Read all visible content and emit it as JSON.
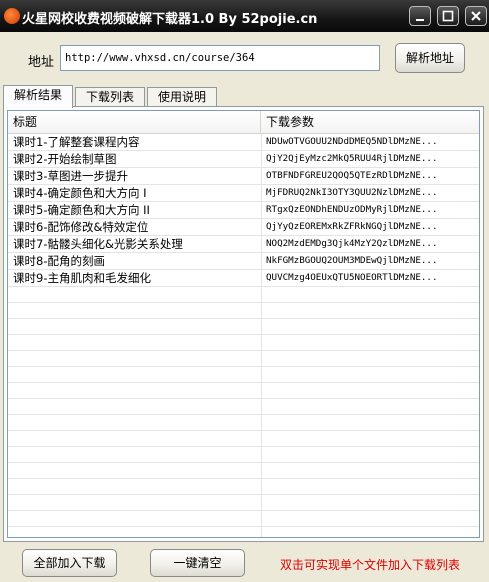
{
  "window": {
    "title": "火星网校收费视频破解下载器1.0 By 52pojie.cn"
  },
  "address": {
    "label": "地址",
    "value": "http://www.vhxsd.cn/course/364",
    "parse_button": "解析地址"
  },
  "tabs": [
    {
      "label": "解析结果",
      "active": true
    },
    {
      "label": "下载列表",
      "active": false
    },
    {
      "label": "使用说明",
      "active": false
    }
  ],
  "table": {
    "columns": [
      "标题",
      "下载参数"
    ],
    "rows": [
      {
        "title": "课时1-了解整套课程内容",
        "param": "NDUwOTVGOUU2NDdDMEQ5NDlDMzNE..."
      },
      {
        "title": "课时2-开始绘制草图",
        "param": "QjY2QjEyMzc2MkQ5RUU4RjlDMzNE..."
      },
      {
        "title": "课时3-草图进一步提升",
        "param": "OTBFNDFGREU2QOQ5QTEzRDlDMzNE..."
      },
      {
        "title": "课时4-确定颜色和大方向 I",
        "param": "MjFDRUQ2NkI3OTY3QUU2NzlDMzNE..."
      },
      {
        "title": "课时5-确定颜色和大方向 II",
        "param": "RTgxQzEONDhENDUzODMyRjlDMzNE..."
      },
      {
        "title": "课时6-配饰修改&特效定位",
        "param": "QjYyQzEOREMxRkZFRkNGQjlDMzNE..."
      },
      {
        "title": "课时7-骷髅头细化&光影关系处理",
        "param": "NOQ2MzdEMDg3Qjk4MzY2QzlDMzNE..."
      },
      {
        "title": "课时8-配角的刻画",
        "param": "NkFGMzBGOUQ2OUM3MDEwQjlDMzNE..."
      },
      {
        "title": "课时9-主角肌肉和毛发细化",
        "param": "QUVCMzg4OEUxQTU5NOEORTlDMzNE..."
      }
    ]
  },
  "footer": {
    "add_all_button": "全部加入下载",
    "clear_button": "一键清空",
    "hint": "双击可实现单个文件加入下载列表"
  },
  "colors": {
    "titlebar": "#151515",
    "hint": "#e00000"
  }
}
